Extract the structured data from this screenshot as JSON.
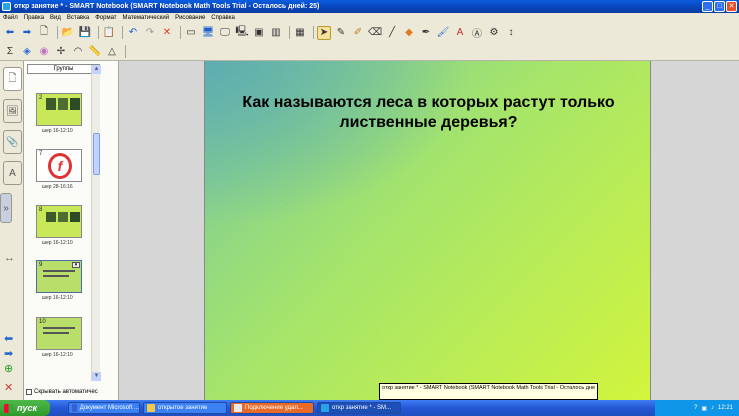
{
  "window": {
    "title": "откр занятие * - SMART Notebook (SMART Notebook Math Tools Trial - Осталось дней: 25)",
    "buttons": [
      "_",
      "□",
      "✕"
    ]
  },
  "menu": [
    "Файл",
    "Правка",
    "Вид",
    "Вставка",
    "Формат",
    "Математический",
    "Рисование",
    "Справка"
  ],
  "sorter": {
    "groups_label": "Группы",
    "thumbs": [
      {
        "num": "2",
        "label": "шер 16-12:10",
        "bg": "#c8e85a"
      },
      {
        "num": "7",
        "label": "шер 28-16:16",
        "bg": "#ffffff"
      },
      {
        "num": "8",
        "label": "шер 16-12:10",
        "bg": "#c8e85a"
      },
      {
        "num": "9",
        "label": "шер 16-12:10",
        "bg": "#b9de6a"
      },
      {
        "num": "10",
        "label": "шер 16-12:10",
        "bg": "#b9de6a"
      }
    ],
    "autohide_label": "Скрывать автоматичес"
  },
  "slide": {
    "question": "Как называются леса в которых растут только лиственные деревья?"
  },
  "tooltip": "откр занятие * - SMART Notebook (SMART Notebook Math Tools Trial - Осталось дне",
  "taskbar": {
    "start_label": "пуск",
    "tasks": [
      "Документ Microsoft ...",
      "открытое занятие",
      "Подключение удал...",
      "откр занятие * - SM..."
    ],
    "lang": "RU",
    "clock": "12:21"
  },
  "colors": {
    "accent_blue": "#0a5ee0",
    "start_green": "#3aa935",
    "slide_green": "#d2f53d"
  }
}
